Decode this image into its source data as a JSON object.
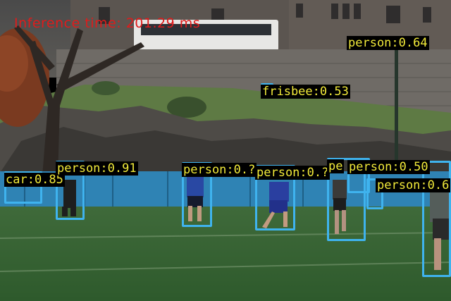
{
  "overlay": {
    "inference_text": "Inference time: 201.29 ms",
    "inference_color": "#e01b1b"
  },
  "style": {
    "box_color": "#3fb3ee",
    "label_text_color": "#f2ea3a",
    "label_bg": "#000000"
  },
  "detections": [
    {
      "class": "person",
      "score": "0.64",
      "text": "person:0.64"
    },
    {
      "class": "frisbee",
      "score": "0.53",
      "text": "frisbee:0.53"
    },
    {
      "class": "car",
      "score": "0.85",
      "text": "car:0.85"
    },
    {
      "class": "person",
      "score": "0.91",
      "text": "person:0.91"
    },
    {
      "class": "person",
      "score": "0.?",
      "text": "person:0.?"
    },
    {
      "class": "person",
      "score": "0.?",
      "text": "person:0.?"
    },
    {
      "class": "person",
      "score": "?",
      "text": "pe"
    },
    {
      "class": "person",
      "score": "0.50",
      "text": "person:0.50"
    },
    {
      "class": "person",
      "score": "0.6?",
      "text": "person:0.6"
    }
  ]
}
